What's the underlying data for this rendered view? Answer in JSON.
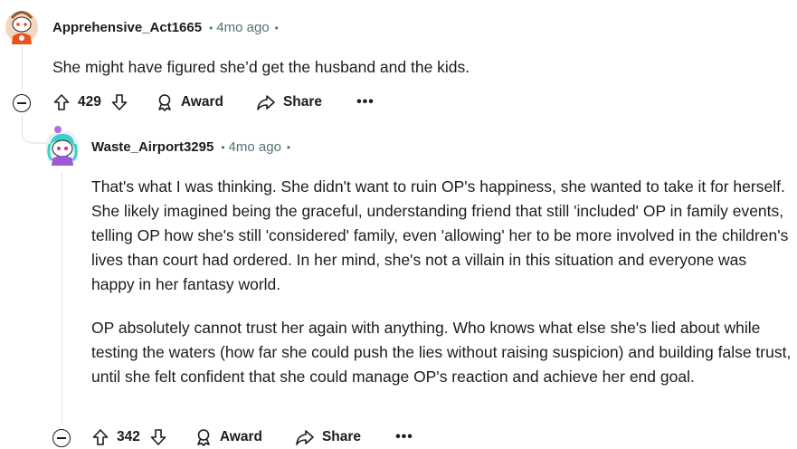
{
  "comments": [
    {
      "username": "Apprehensive_Act1665",
      "separator": "•",
      "time": "4mo ago",
      "trailing_dot": "•",
      "paragraphs": [
        "She might have figured she’d get the husband and the kids."
      ],
      "votes": "429",
      "award_label": "Award",
      "share_label": "Share",
      "more_label": "•••"
    },
    {
      "username": "Waste_Airport3295",
      "separator": "•",
      "time": "4mo ago",
      "trailing_dot": "•",
      "paragraphs": [
        "That's what I was thinking. She didn't want to ruin OP's happiness, she wanted to take it for herself. She likely imagined being the graceful, understanding friend that still 'included' OP in family events, telling OP how she's still 'considered' family, even 'allowing' her to be more involved in the children's lives than court had ordered. In her mind, she's not a villain in this situation and everyone was happy in her fantasy world.",
        "OP absolutely cannot trust her again with anything. Who knows what else she's lied about while testing the waters (how far she could push the lies without raising suspicion) and building false trust, until she felt confident that she could manage OP's reaction and achieve her end goal."
      ],
      "votes": "342",
      "award_label": "Award",
      "share_label": "Share",
      "more_label": "•••"
    }
  ]
}
